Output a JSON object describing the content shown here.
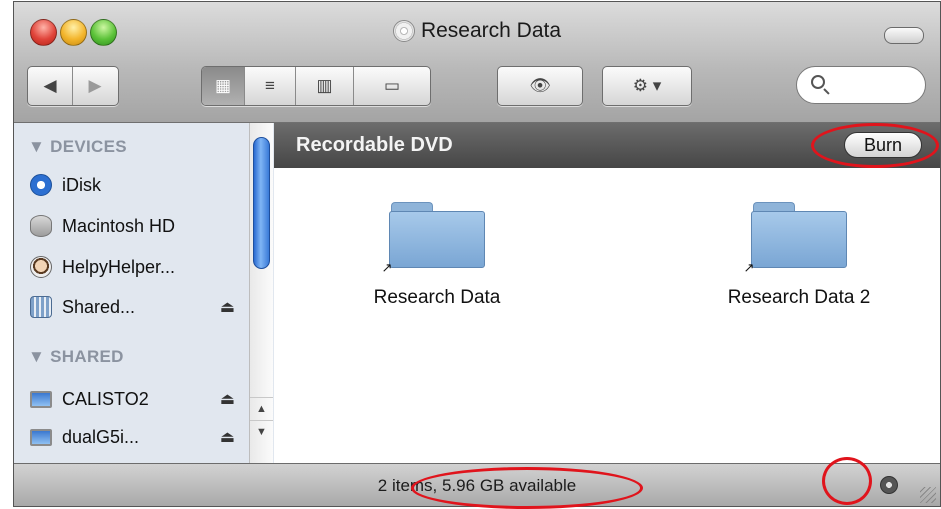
{
  "window": {
    "title": "Research Data",
    "title_icon": "dvd-disc-icon"
  },
  "toolbar": {
    "back_label": "◀",
    "forward_label": "▶",
    "view_icon_label": "▦",
    "view_list_label": "≡",
    "view_column_label": "▥",
    "view_coverflow_label": "▭",
    "quicklook_label": "👁",
    "action_label": "⚙ ▾",
    "search_placeholder": ""
  },
  "sidebar": {
    "devices_header": "▼ DEVICES",
    "devices": [
      {
        "label": "iDisk",
        "icon": "idisk-icon",
        "eject": ""
      },
      {
        "label": "Macintosh HD",
        "icon": "hard-drive-icon",
        "eject": ""
      },
      {
        "label": "HelpyHelper...",
        "icon": "home-icon",
        "eject": ""
      },
      {
        "label": "Shared...",
        "icon": "shared-volume-icon",
        "eject": "⏏"
      }
    ],
    "shared_header": "▼ SHARED",
    "shared": [
      {
        "label": "CALISTO2",
        "icon": "computer-icon",
        "eject": "⏏"
      },
      {
        "label": "dualG5i...",
        "icon": "computer-icon",
        "eject": "⏏"
      }
    ]
  },
  "content": {
    "header_title": "Recordable DVD",
    "burn_label": "Burn",
    "items": [
      {
        "label": "Research Data",
        "icon": "folder-alias-icon"
      },
      {
        "label": "Research Data 2",
        "icon": "folder-alias-icon"
      }
    ]
  },
  "status": {
    "text": "2 items, 5.96 GB available",
    "spinner_icon": "burn-progress-icon"
  },
  "annotations": {
    "highlight_color": "#e0141c",
    "highlighted": [
      "burn-button",
      "status-available-space",
      "burn-progress-icon"
    ]
  }
}
